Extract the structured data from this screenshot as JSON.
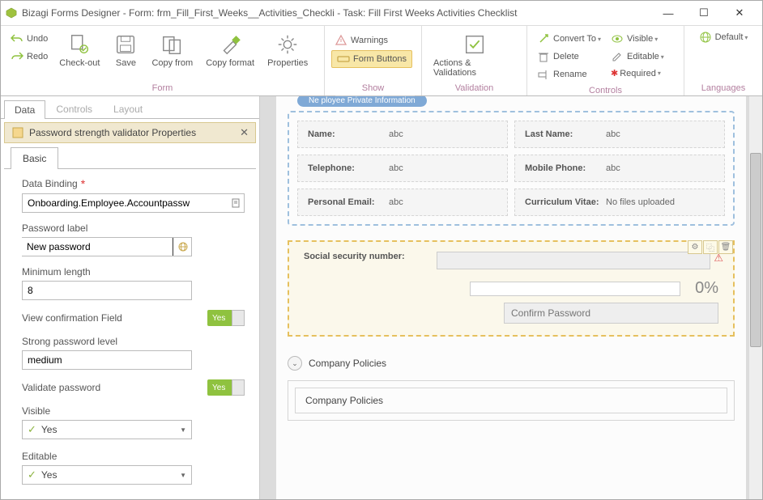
{
  "window": {
    "title": "Bizagi Forms Designer  - Form: frm_Fill_First_Weeks__Activities_Checkli - Task:  Fill First Weeks  Activities Checklist"
  },
  "ribbon": {
    "undo": "Undo",
    "redo": "Redo",
    "checkout": "Check-out",
    "save": "Save",
    "copyfrom": "Copy from",
    "copyformat": "Copy format",
    "properties": "Properties",
    "group_form": "Form",
    "warnings": "Warnings",
    "formbuttons": "Form Buttons",
    "group_show": "Show",
    "actions": "Actions & Validations",
    "group_validation": "Validation",
    "convertto": "Convert To",
    "delete": "Delete",
    "rename": "Rename",
    "visible": "Visible",
    "editable": "Editable",
    "required": "Required",
    "group_controls": "Controls",
    "default": "Default",
    "group_languages": "Languages"
  },
  "floating_tooltip": "Form Buttons",
  "left": {
    "tabs": {
      "data": "Data",
      "controls": "Controls",
      "layout": "Layout"
    },
    "header": "Password strength validator Properties",
    "basic": "Basic",
    "databinding_label": "Data Binding",
    "databinding_value": "Onboarding.Employee.Accountpassw",
    "pwdlabel_label": "Password label",
    "pwdlabel_value": "New password",
    "minlen_label": "Minimum length",
    "minlen_value": "8",
    "viewconfirm_label": "View confirmation Field",
    "yes_toggle": "Yes",
    "stronglevel_label": "Strong password level",
    "stronglevel_value": "medium",
    "validatepwd_label": "Validate password",
    "visible_label": "Visible",
    "visible_value": "Yes",
    "editable_label": "Editable",
    "editable_value": "Yes"
  },
  "canvas": {
    "group_title": "Ne        ployee Private Information",
    "fields": {
      "name_lbl": "Name:",
      "name_val": "abc",
      "lastname_lbl": "Last Name:",
      "lastname_val": "abc",
      "telephone_lbl": "Telephone:",
      "telephone_val": "abc",
      "mobile_lbl": "Mobile Phone:",
      "mobile_val": "abc",
      "email_lbl": "Personal Email:",
      "email_val": "abc",
      "cv_lbl": "Curriculum Vitae:",
      "cv_val": "No files uploaded"
    },
    "ssn_label": "Social security number:",
    "strength_pct": "0%",
    "confirm_placeholder": "Confirm Password",
    "acc_title": "Company Policies",
    "acc_inner": "Company Policies"
  }
}
